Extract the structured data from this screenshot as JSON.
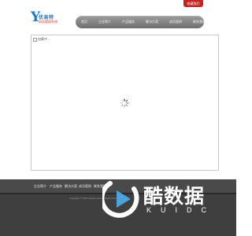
{
  "header": {
    "logo_letter": "Y",
    "logo_title": "优易特",
    "logo_subtitle": "网站管理系统",
    "top_button": "收藏我们"
  },
  "nav": {
    "items": [
      "首页",
      "企业简介",
      "产品服务",
      "解决方案",
      "成功案例",
      "联系我们"
    ]
  },
  "content": {
    "image_alt": "加载中..."
  },
  "footer": {
    "links": [
      "企业简介",
      "产品服务",
      "解决方案",
      "成功案例",
      "联系我们"
    ],
    "copyright": "Copyright © 2015 youyite.com All Rights Reserved"
  },
  "watermark": {
    "title": "酷数据",
    "subtitle": "KUIDC"
  }
}
